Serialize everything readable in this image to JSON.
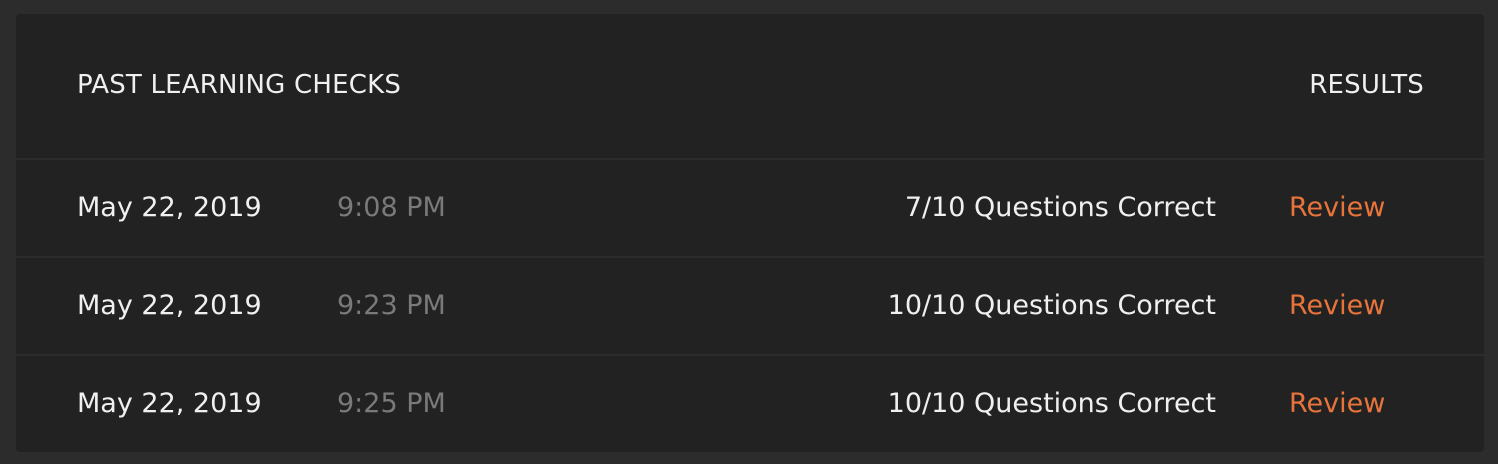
{
  "header": {
    "title": "PAST LEARNING CHECKS",
    "results_label": "RESULTS"
  },
  "rows": [
    {
      "date": "May 22, 2019",
      "time": "9:08 PM",
      "score": "7/10 Questions Correct",
      "action": "Review"
    },
    {
      "date": "May 22, 2019",
      "time": "9:23 PM",
      "score": "10/10 Questions Correct",
      "action": "Review"
    },
    {
      "date": "May 22, 2019",
      "time": "9:25 PM",
      "score": "10/10 Questions Correct",
      "action": "Review"
    }
  ],
  "colors": {
    "background": "#2c2c2c",
    "panel": "#222222",
    "text": "#f0f0f0",
    "muted": "#7a7a7a",
    "accent": "#e8743b"
  }
}
